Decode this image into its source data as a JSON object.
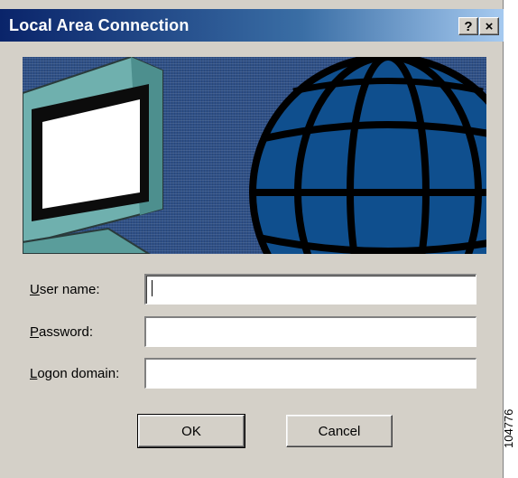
{
  "window": {
    "title": "Local Area Connection",
    "help_label": "?",
    "close_label": "×"
  },
  "banner": {
    "illustration": "computer-and-globe",
    "colors": {
      "background": "#2e4f86",
      "globe": "#0f4f8e",
      "monitor": "#6fb0ae"
    }
  },
  "form": {
    "username": {
      "label_key": "U",
      "label_rest": "ser name:",
      "value": ""
    },
    "password": {
      "label_key": "P",
      "label_rest": "assword:",
      "value": ""
    },
    "domain": {
      "label_key": "L",
      "label_rest": "ogon domain:",
      "value": ""
    }
  },
  "buttons": {
    "ok": "OK",
    "cancel": "Cancel"
  },
  "figure_id": "104776"
}
